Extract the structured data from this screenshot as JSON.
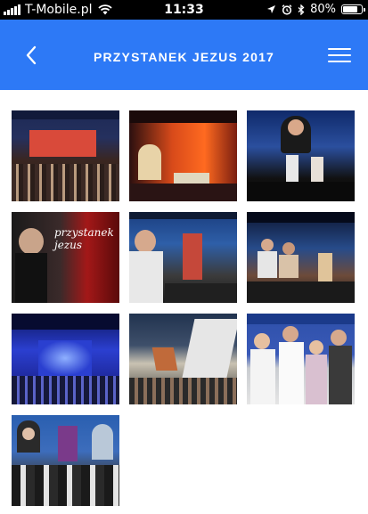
{
  "status_bar": {
    "carrier": "T-Mobile.pl",
    "time": "11:33",
    "battery": "80%",
    "battery_level": 0.8,
    "icons": [
      "signal-icon",
      "wifi-icon",
      "location-icon",
      "alarm-icon",
      "bluetooth-icon",
      "battery-icon"
    ]
  },
  "header": {
    "title": "PRZYSTANEK JEZUS 2017",
    "background_color": "#2d79f6",
    "back_icon": "chevron-left-icon",
    "menu_icon": "hamburger-menu-icon"
  },
  "gallery": {
    "photos": [
      {
        "description": "stage with red backdrop and crowd"
      },
      {
        "description": "orange stage with speaker"
      },
      {
        "description": "man speaking at podium"
      },
      {
        "description": "przystanek jezus logo screen",
        "text": "przystanek jezus"
      },
      {
        "description": "man singing with microphone"
      },
      {
        "description": "band performing on stage"
      },
      {
        "description": "blue lit stage with crowd"
      },
      {
        "description": "crowd waving flags"
      },
      {
        "description": "group photo of four people"
      },
      {
        "description": "people in robes on stage"
      }
    ]
  }
}
